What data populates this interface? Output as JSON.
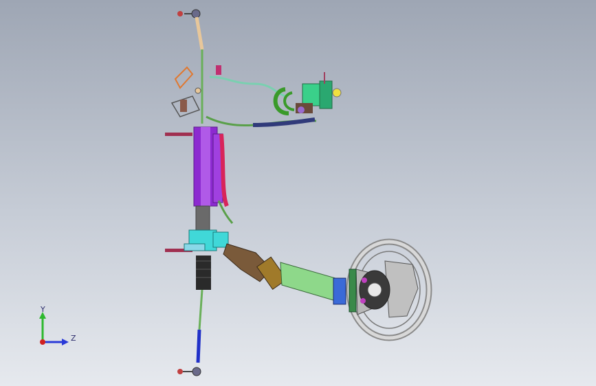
{
  "viewport": {
    "background_top": "#9ea6b4",
    "background_bottom": "#e6e9ee"
  },
  "triad": {
    "y_label": "Y",
    "z_label": "Z",
    "y_color": "#2db82d",
    "z_color": "#2a3ad8",
    "x_color": "#d02020"
  },
  "model": {
    "name_icon": "steering-assembly-icon",
    "colors": {
      "tie_rod_upper": "#e8c79a",
      "tie_rod_lower": "#2030c8",
      "rack_housing": "#8c2ad0",
      "hose_red": "#d8245a",
      "hose_green": "#5aa04a",
      "hose_navy": "#303a7a",
      "pump": "#3ad08a",
      "column_brown": "#7a5a3a",
      "column_green": "#8ed88a",
      "cyan_parts": "#40d8d8",
      "wheel": "#c8c8c8"
    }
  }
}
